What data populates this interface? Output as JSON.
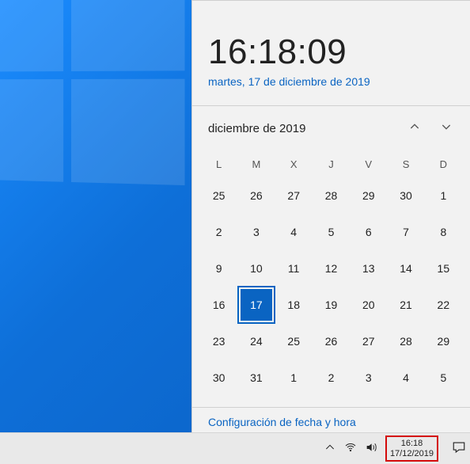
{
  "clock": {
    "time": "16:18:09",
    "long_date": "martes, 17 de diciembre de 2019"
  },
  "calendar": {
    "month_label": "diciembre de 2019",
    "weekdays": [
      "L",
      "M",
      "X",
      "J",
      "V",
      "S",
      "D"
    ],
    "weeks": [
      [
        {
          "d": "25",
          "other": true
        },
        {
          "d": "26",
          "other": true
        },
        {
          "d": "27",
          "other": true
        },
        {
          "d": "28",
          "other": true
        },
        {
          "d": "29",
          "other": true
        },
        {
          "d": "30",
          "other": true
        },
        {
          "d": "1",
          "other": false
        }
      ],
      [
        {
          "d": "2"
        },
        {
          "d": "3"
        },
        {
          "d": "4"
        },
        {
          "d": "5"
        },
        {
          "d": "6"
        },
        {
          "d": "7"
        },
        {
          "d": "8"
        }
      ],
      [
        {
          "d": "9"
        },
        {
          "d": "10"
        },
        {
          "d": "11"
        },
        {
          "d": "12"
        },
        {
          "d": "13"
        },
        {
          "d": "14"
        },
        {
          "d": "15"
        }
      ],
      [
        {
          "d": "16"
        },
        {
          "d": "17",
          "today": true
        },
        {
          "d": "18"
        },
        {
          "d": "19"
        },
        {
          "d": "20"
        },
        {
          "d": "21"
        },
        {
          "d": "22"
        }
      ],
      [
        {
          "d": "23"
        },
        {
          "d": "24"
        },
        {
          "d": "25"
        },
        {
          "d": "26"
        },
        {
          "d": "27"
        },
        {
          "d": "28"
        },
        {
          "d": "29"
        }
      ],
      [
        {
          "d": "30"
        },
        {
          "d": "31"
        },
        {
          "d": "1",
          "other": true
        },
        {
          "d": "2",
          "other": true
        },
        {
          "d": "3",
          "other": true
        },
        {
          "d": "4",
          "other": true
        },
        {
          "d": "5",
          "other": true
        }
      ]
    ]
  },
  "settings_link": "Configuración de fecha y hora",
  "taskbar": {
    "time": "16:18",
    "date": "17/12/2019"
  }
}
